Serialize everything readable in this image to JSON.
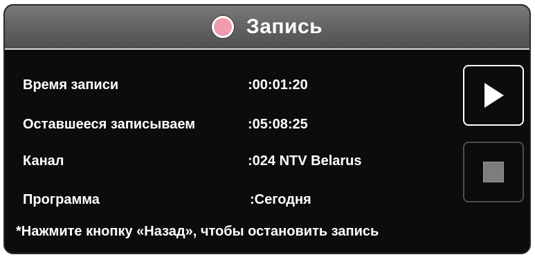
{
  "dialog": {
    "title": "Запись",
    "accent_color": "#f19bae",
    "rows": [
      {
        "label": "Время записи",
        "value": ":00:01:20"
      },
      {
        "label": "Оставшееся записываем",
        "value": ":05:08:25"
      },
      {
        "label": "Канал",
        "value": ":024 NTV Belarus"
      },
      {
        "label": "Программа",
        "value": ":Сегодня"
      }
    ],
    "note": "*Нажмите кнопку «Назад», чтобы остановить запись",
    "buttons": {
      "play_icon": "play-icon",
      "stop_icon": "stop-icon"
    }
  }
}
